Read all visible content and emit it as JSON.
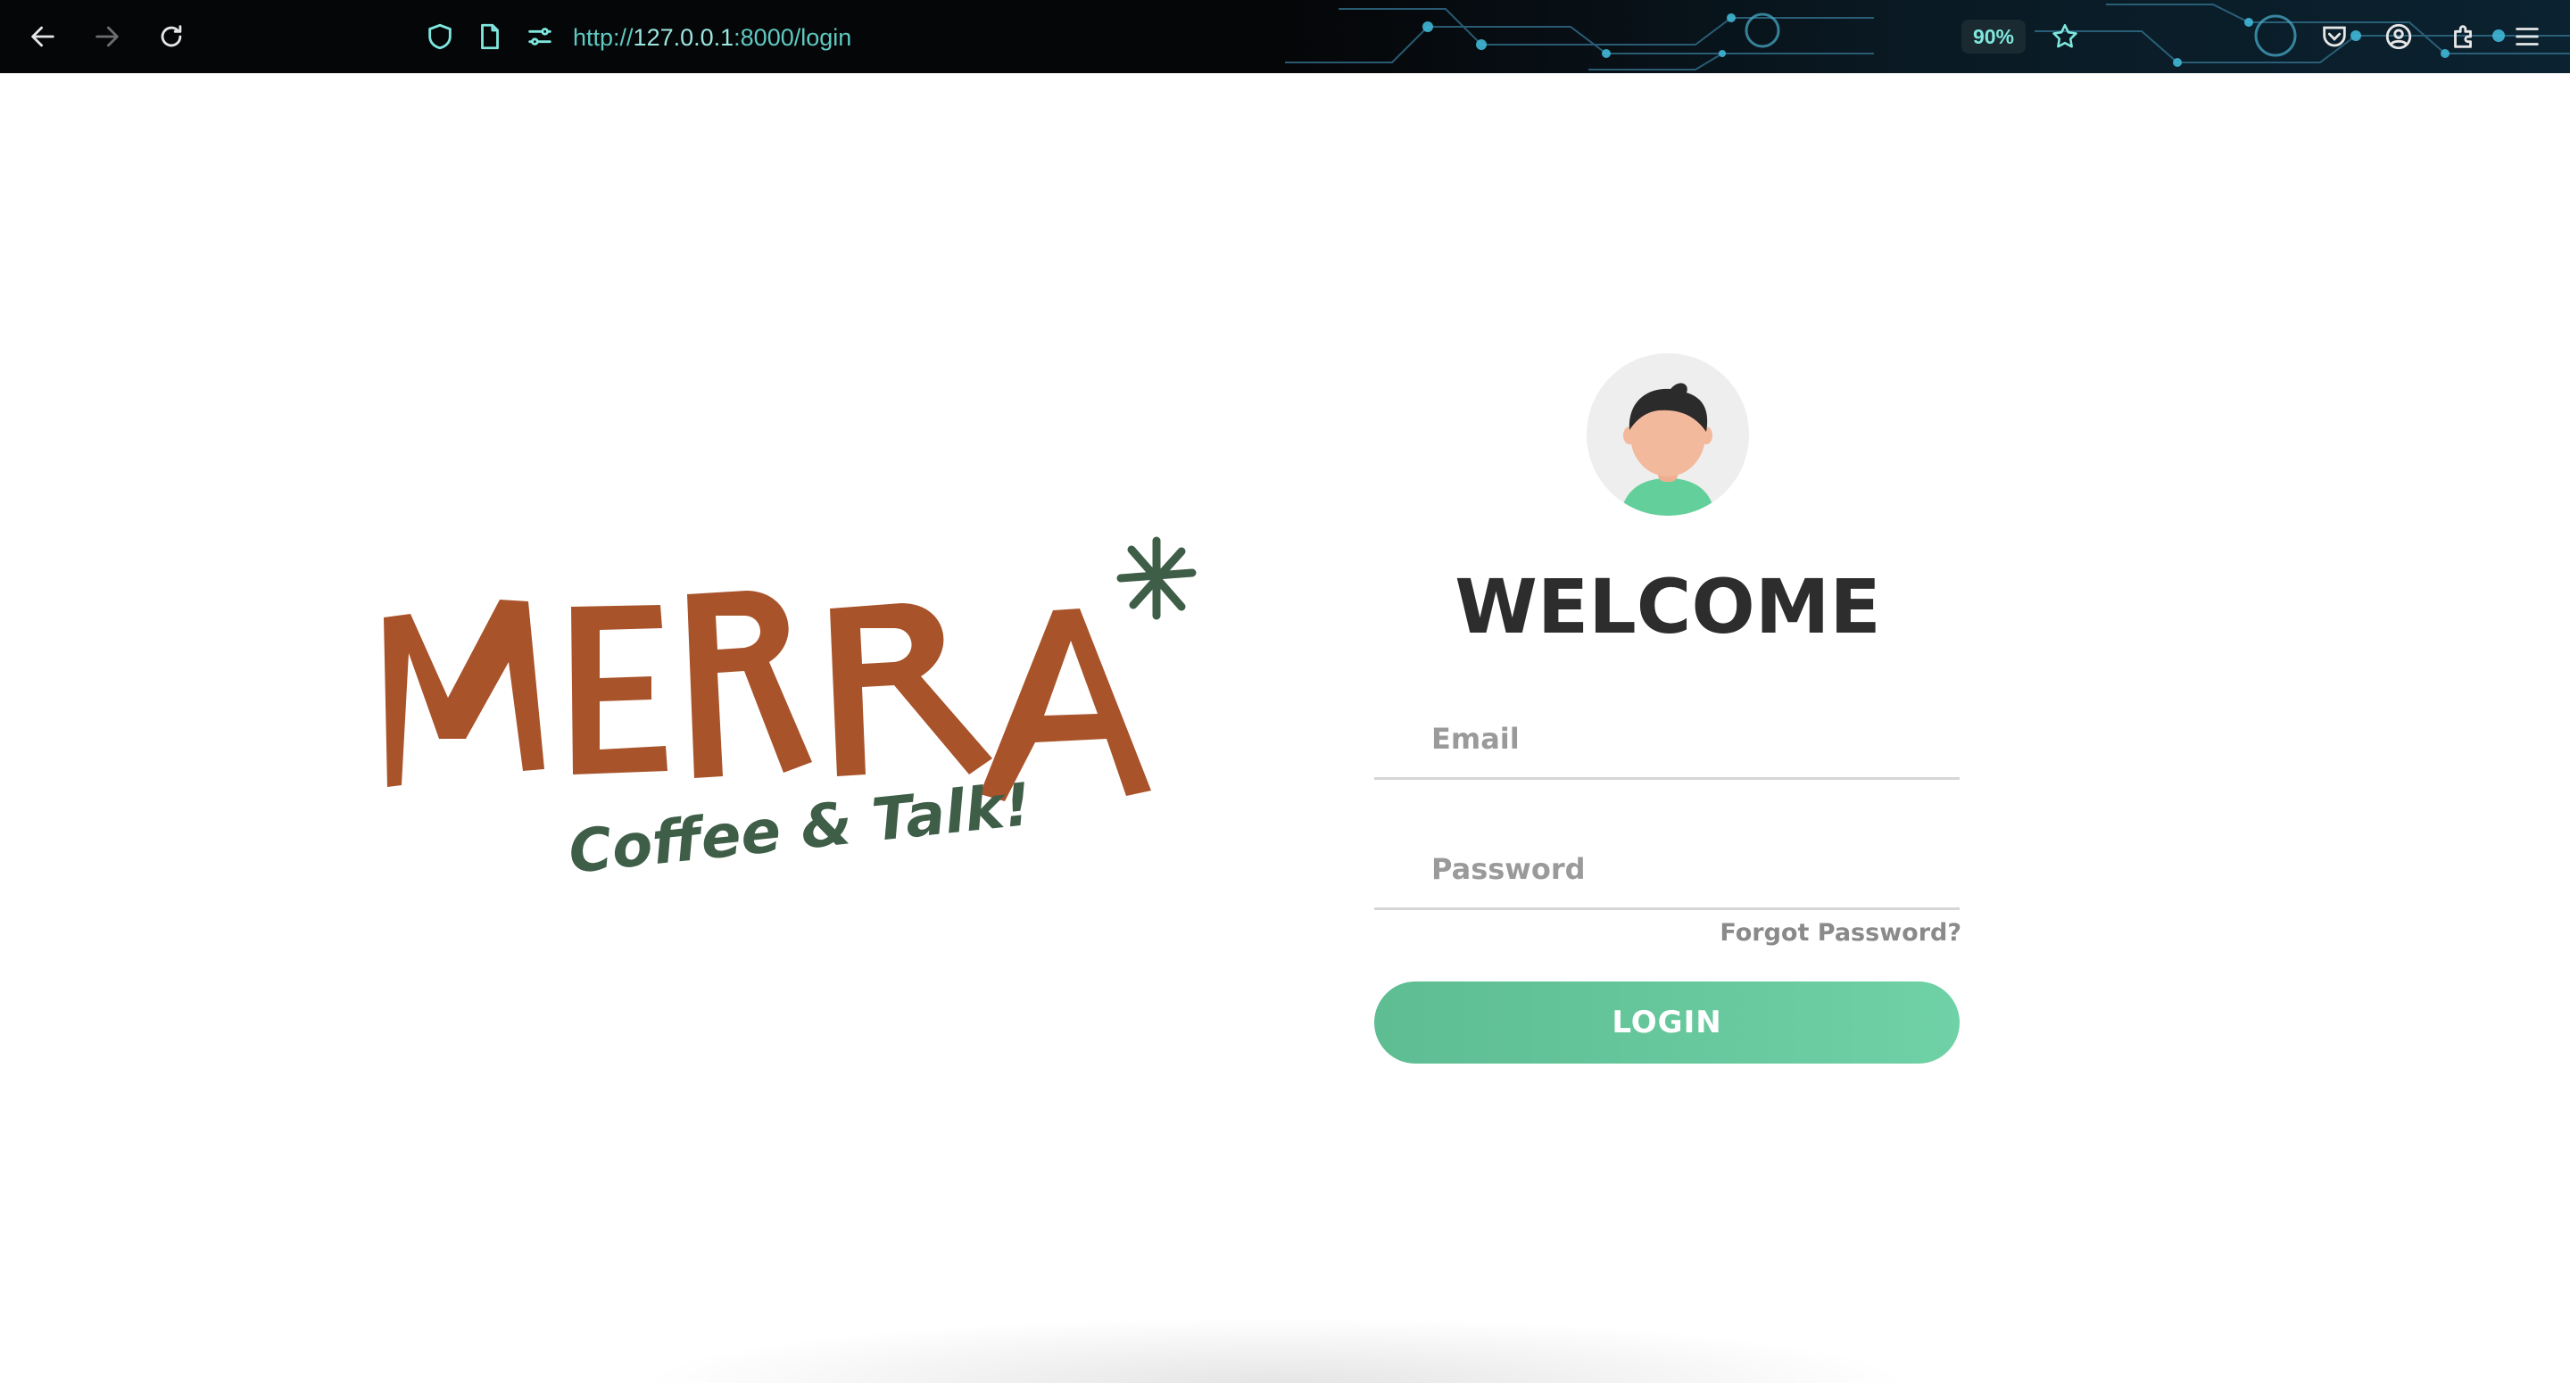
{
  "browser": {
    "url_scheme": "http://",
    "url_host": "127.0.0.1",
    "url_rest": ":8000/login",
    "zoom": "90%",
    "icons": [
      "back-icon",
      "forward-icon",
      "reload-icon",
      "shield-icon",
      "page-icon",
      "permissions-icon",
      "star-icon",
      "pocket-icon",
      "account-icon",
      "extensions-icon",
      "menu-icon"
    ],
    "accent_color": "#5fc9c2"
  },
  "logo": {
    "brand": "MERRA",
    "tagline": "Coffee & Talk!",
    "brand_color": "#a9532a",
    "tagline_color": "#3f5e48"
  },
  "login": {
    "welcome": "WELCOME",
    "email_placeholder": "Email",
    "password_placeholder": "Password",
    "forgot_label": "Forgot Password?",
    "button_label": "LOGIN",
    "button_color": "#5ebd92"
  }
}
